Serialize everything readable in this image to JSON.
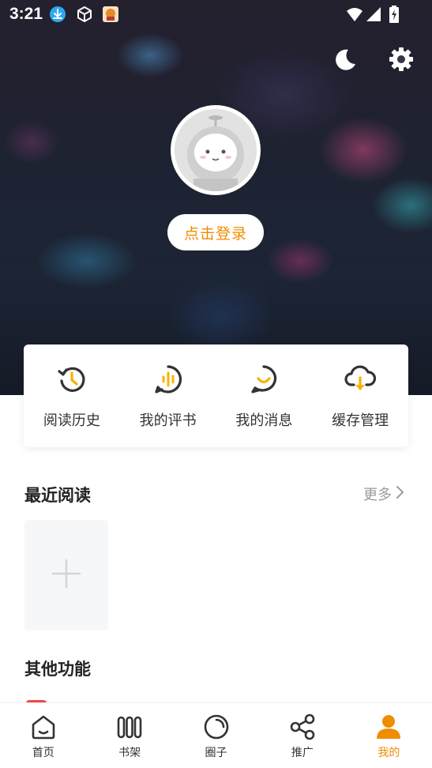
{
  "status_bar": {
    "time": "3:21",
    "icons": [
      "download-notification-icon",
      "cube-notification-icon",
      "app-notification-icon",
      "wifi-icon",
      "signal-icon",
      "battery-charging-icon"
    ]
  },
  "header": {
    "actions": [
      "night-mode-icon",
      "settings-icon"
    ]
  },
  "profile": {
    "login_label": "点击登录"
  },
  "quick_actions": [
    {
      "label": "阅读历史",
      "icon": "history-icon"
    },
    {
      "label": "我的评书",
      "icon": "audio-review-icon"
    },
    {
      "label": "我的消息",
      "icon": "message-icon"
    },
    {
      "label": "缓存管理",
      "icon": "cloud-download-icon"
    }
  ],
  "recent": {
    "title": "最近阅读",
    "more_label": "更多"
  },
  "other": {
    "title": "其他功能"
  },
  "bottom_nav": [
    {
      "label": "首页",
      "icon": "home-icon"
    },
    {
      "label": "书架",
      "icon": "bookshelf-icon"
    },
    {
      "label": "圈子",
      "icon": "circle-icon"
    },
    {
      "label": "推广",
      "icon": "share-icon"
    },
    {
      "label": "我的",
      "icon": "profile-icon",
      "active": true
    }
  ],
  "colors": {
    "accent": "#f08c00",
    "accent_yellow": "#f5b400",
    "icon_dark": "#333333"
  }
}
